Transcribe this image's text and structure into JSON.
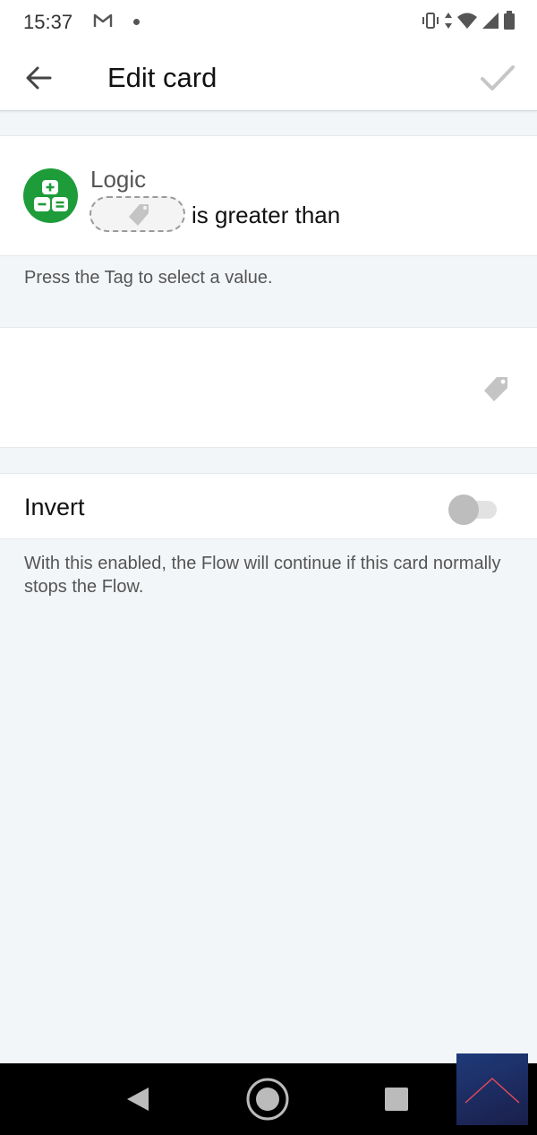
{
  "status_bar": {
    "time": "15:37",
    "icons": [
      "gmail-icon",
      "notification-dot",
      "vibrate-icon",
      "data-arrows-icon",
      "wifi-icon",
      "signal-icon",
      "battery-icon"
    ]
  },
  "app_bar": {
    "title": "Edit card",
    "back_icon": "arrow-left-icon",
    "confirm_icon": "check-icon"
  },
  "card": {
    "category": "Logic",
    "condition": "is greater than",
    "icon": "logic-calculator-icon",
    "accent_color": "#1e9c3a"
  },
  "hint": "Press the Tag to select a value.",
  "value_field": {
    "icon": "tag-icon"
  },
  "invert": {
    "label": "Invert",
    "enabled": false,
    "description": "With this enabled, the Flow will continue if this card normally stops the Flow."
  },
  "nav_bar": {
    "icons": [
      "nav-back-icon",
      "nav-home-icon",
      "nav-recents-icon"
    ]
  },
  "scroll_top_icon": "chevron-up-icon"
}
